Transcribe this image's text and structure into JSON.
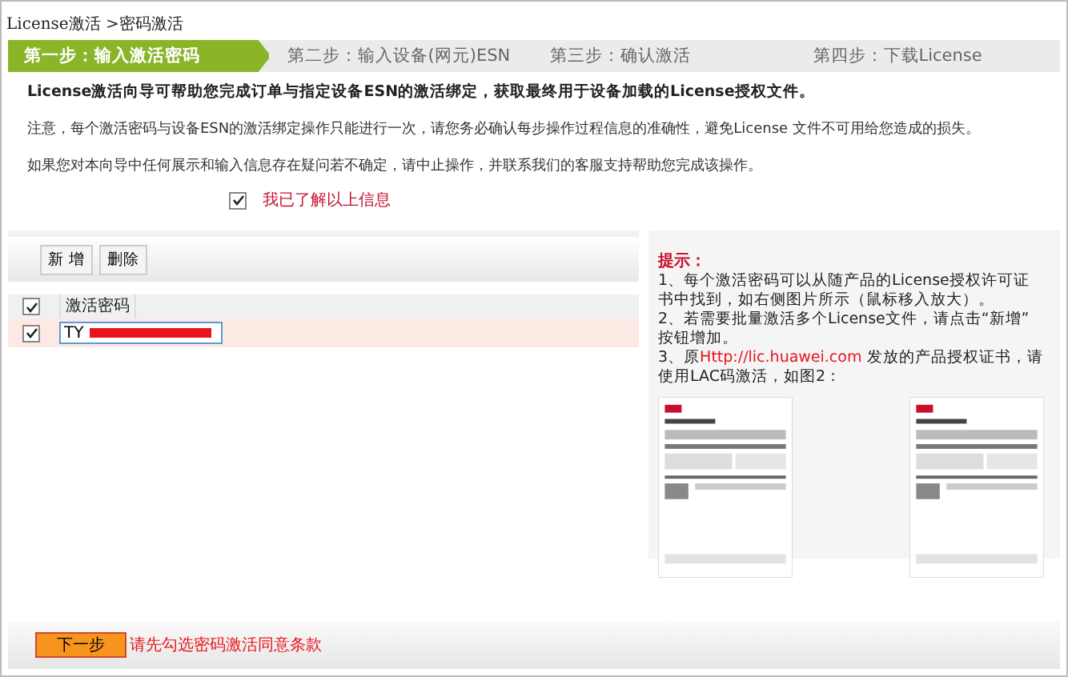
{
  "breadcrumb": "License激活 >密码激活",
  "steps": [
    {
      "label": "第一步：输入激活密码",
      "selected": true
    },
    {
      "label": "第二步：输入设备(网元)ESN",
      "selected": false
    },
    {
      "label": "第三步：确认激活",
      "selected": false
    },
    {
      "label": "第四步：下载License",
      "selected": false
    }
  ],
  "intro": "License激活向导可帮助您完成订单与指定设备ESN的激活绑定，获取最终用于设备加载的License授权文件。",
  "notices": [
    "注意，每个激活密码与设备ESN的激活绑定操作只能进行一次，请您务必确认每步操作过程信息的准确性，避免License 文件不可用给您造成的损失。",
    "如果您对本向导中任何展示和输入信息存在疑问若不确定，请中止操作，并联系我们的客服支持帮助您完成该操作。"
  ],
  "agree": {
    "label": "我已了解以上信息",
    "checked": true
  },
  "toolbar": [
    "新 增",
    "删除"
  ],
  "table": {
    "header": {
      "label": "激活密码",
      "checked": true
    },
    "rows": [
      {
        "value": "TY",
        "checked": true
      }
    ]
  },
  "tips": {
    "title": "提示：",
    "items": [
      {
        "kind": "text",
        "text": "1、每个激活密码可以从随产品的License授权许可证书中找到，如右侧图片所示（鼠标移入放大）。"
      },
      {
        "kind": "text",
        "text": "2、若需要批量激活多个License文件，请点击“新增” 按钮增加。"
      },
      {
        "kind": "link",
        "before": "3、原",
        "link": "Http://lic.huawei.com",
        "after": " 发放的产品授权证书，请使用LAC码激活，如图2："
      }
    ]
  },
  "next_button": "下一步",
  "warning": "请先勾选密码激活同意条款"
}
